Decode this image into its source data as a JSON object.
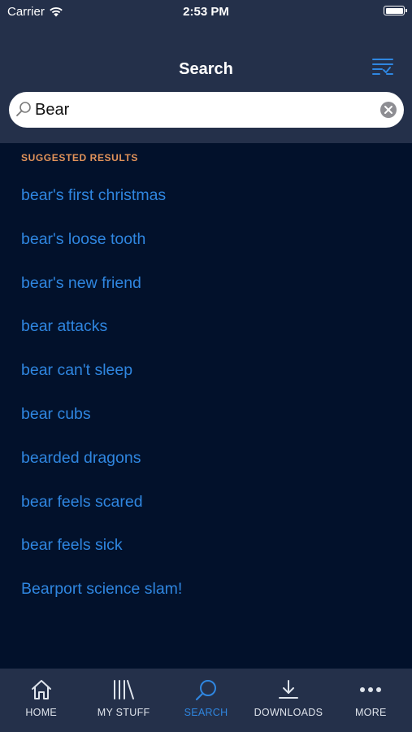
{
  "status_bar": {
    "carrier": "Carrier",
    "time": "2:53 PM"
  },
  "header": {
    "title": "Search"
  },
  "search": {
    "value": "Bear",
    "placeholder": ""
  },
  "suggestions": {
    "label": "SUGGESTED RESULTS",
    "items": [
      "bear's first christmas",
      "bear's loose tooth",
      "bear's new friend",
      "bear attacks",
      "bear can't sleep",
      "bear cubs",
      "bearded dragons",
      "bear feels scared",
      "bear feels sick",
      "Bearport science slam!"
    ]
  },
  "tabbar": {
    "tabs": [
      {
        "label": "HOME",
        "icon": "home-icon"
      },
      {
        "label": "MY STUFF",
        "icon": "library-icon"
      },
      {
        "label": "SEARCH",
        "icon": "search-icon",
        "active": true
      },
      {
        "label": "DOWNLOADS",
        "icon": "download-icon"
      },
      {
        "label": "MORE",
        "icon": "more-icon"
      }
    ]
  },
  "colors": {
    "background": "#02112b",
    "header": "#24304a",
    "accent": "#2f86e0",
    "section_label": "#e2935a"
  }
}
